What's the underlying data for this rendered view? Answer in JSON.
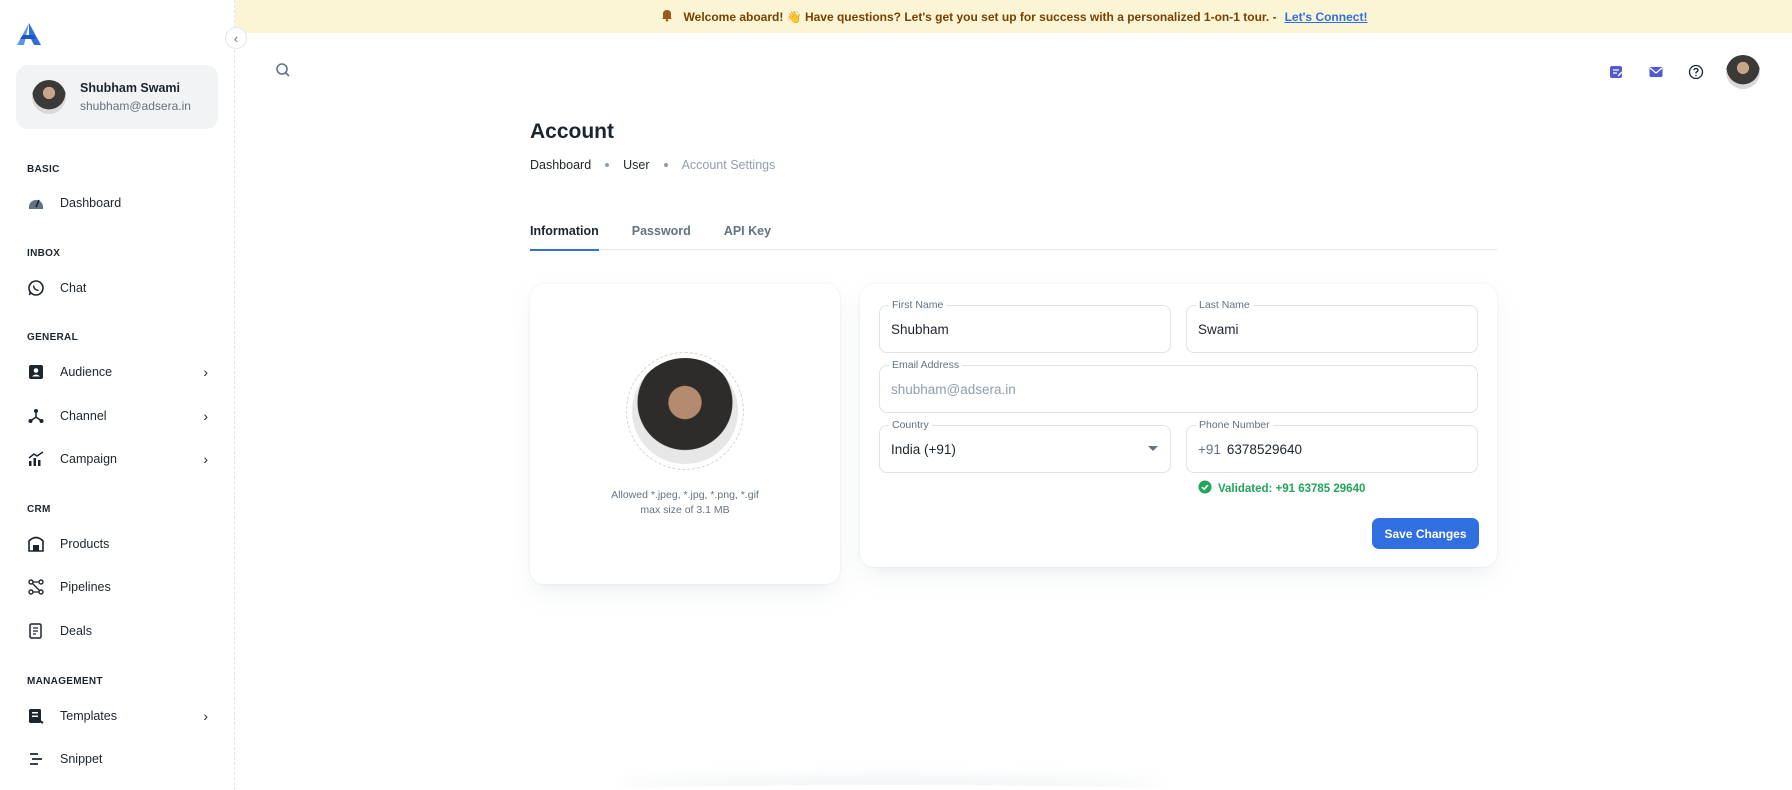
{
  "banner": {
    "text": "Welcome aboard! 👋 Have questions? Let's get you set up for success with a personalized 1-on-1 tour. -",
    "link": "Let's Connect!"
  },
  "sidebar": {
    "user": {
      "name": "Shubham Swami",
      "email": "shubham@adsera.in"
    },
    "sections": {
      "basic": "BASIC",
      "inbox": "INBOX",
      "general": "GENERAL",
      "crm": "CRM",
      "management": "MANAGEMENT"
    },
    "items": {
      "dashboard": "Dashboard",
      "chat": "Chat",
      "audience": "Audience",
      "channel": "Channel",
      "campaign": "Campaign",
      "products": "Products",
      "pipelines": "Pipelines",
      "deals": "Deals",
      "templates": "Templates",
      "snippet": "Snippet"
    }
  },
  "header": {
    "title": "Account"
  },
  "breadcrumb": [
    "Dashboard",
    "User",
    "Account Settings"
  ],
  "tabs": [
    "Information",
    "Password",
    "API Key"
  ],
  "photo": {
    "hint_line1": "Allowed *.jpeg, *.jpg, *.png, *.gif",
    "hint_line2": "max size of 3.1 MB"
  },
  "form": {
    "first_name_label": "First Name",
    "first_name": "Shubham",
    "last_name_label": "Last Name",
    "last_name": "Swami",
    "email_label": "Email Address",
    "email": "shubham@adsera.in",
    "country_label": "Country",
    "country": "India (+91)",
    "phone_label": "Phone Number",
    "phone_prefix": "+91",
    "phone": "6378529640",
    "validated": "Validated: +91 63785 29640",
    "save": "Save Changes"
  },
  "colors": {
    "accent": "#2f6fe0",
    "banner_bg": "#fbf5d6",
    "success": "#22a55a"
  }
}
